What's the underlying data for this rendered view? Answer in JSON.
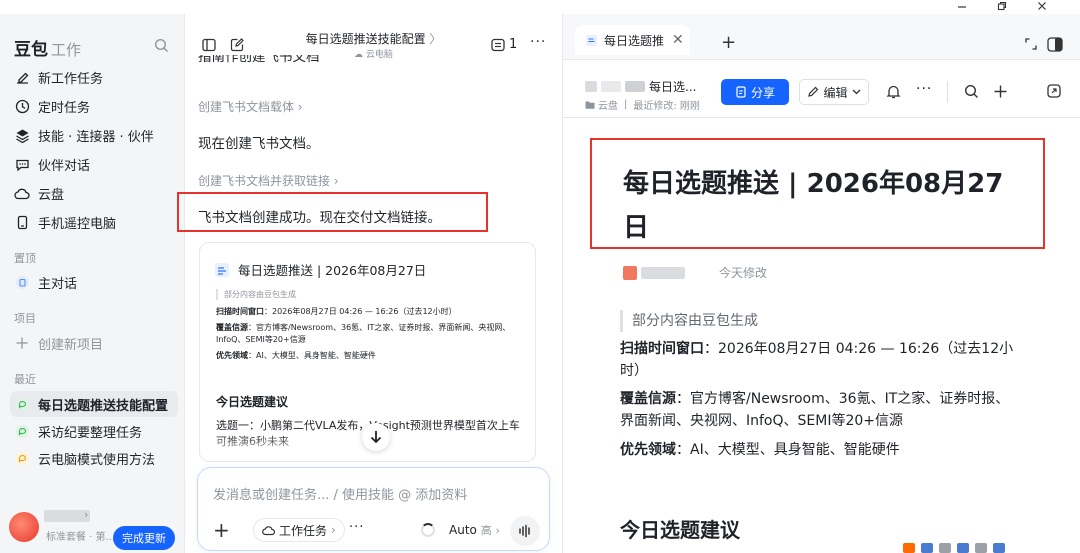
{
  "app": {
    "brand": "豆包",
    "brand_sub": "工作"
  },
  "sidebar": {
    "items": [
      {
        "label": "新工作任务",
        "icon": "edit-icon"
      },
      {
        "label": "定时任务",
        "icon": "clock-icon"
      },
      {
        "label": "技能 · 连接器 · 伙伴",
        "icon": "layers-icon"
      },
      {
        "label": "伙伴对话",
        "icon": "chat-icon"
      },
      {
        "label": "云盘",
        "icon": "cloud-icon"
      },
      {
        "label": "手机遥控电脑",
        "icon": "phone-icon"
      }
    ],
    "pinned_label": "置顶",
    "pinned": [
      {
        "label": "主对话"
      }
    ],
    "projects_label": "项目",
    "new_project": "创建新项目",
    "recent_label": "最近",
    "recent": [
      {
        "label": "每日选题推送技能配置",
        "active": true
      },
      {
        "label": "采访纪要整理任务",
        "active": false
      },
      {
        "label": "云电脑模式使用方法",
        "active": false
      }
    ],
    "account": {
      "plan": "标准套餐 · 第...",
      "upgrade": "完成更新"
    }
  },
  "chat": {
    "title": "每日选题推送技能配置",
    "subtitle": "云电脑",
    "count": "1",
    "cut_text": "指南作创建飞书文档",
    "step1": "创建飞书文档载体",
    "msg1": "现在创建飞书文档。",
    "step2": "创建飞书文档并获取链接",
    "msg2": "飞书文档创建成功。现在交付文档链接。",
    "card": {
      "title": "每日选题推送 | 2026年08月27日",
      "quote": "部分内容由豆包生成",
      "scan_label": "扫描时间窗口",
      "scan_value": "：2026年08月27日 04:26 — 16:26（过去12小时）",
      "source_label": "覆盖信源",
      "source_value": "：官方博客/Newsroom、36氪、IT之家、证券时报、界面新闻、央视网、InfoQ、SEMI等20+信源",
      "priority_label": "优先领域",
      "priority_value": "：AI、大模型、具身智能、智能硬件",
      "h2": "今日选题建议",
      "body": "选题一：小鹏第二代VLA发布，Vesight预测世界模型首次上车可推演6秒未来"
    },
    "composer": {
      "placeholder": "发消息或创建任务... / 使用技能 @ 添加资料",
      "task_pill": "工作任务",
      "mode": "Auto",
      "level": "高"
    }
  },
  "doc": {
    "tab_title": "每日选题推送",
    "doc_name": "每日选...",
    "location": "云盘",
    "modified": "最近修改: 刚刚",
    "share": "分享",
    "edit": "编辑",
    "title": "每日选题推送 | 2026年08月27日",
    "author_time": "今天修改",
    "quote": "部分内容由豆包生成",
    "scan_label": "扫描时间窗口",
    "scan_value": "：2026年08月27日 04:26 — 16:26（过去12小时）",
    "source_label": "覆盖信源",
    "source_value": "：官方博客/Newsroom、36氪、IT之家、证券时报、界面新闻、央视网、InfoQ、SEMI等20+信源",
    "priority_label": "优先领域",
    "priority_value": "：AI、大模型、具身智能、智能硬件",
    "h2": "今日选题建议"
  },
  "colors": {
    "accent": "#1664ff",
    "highlight_box": "#e5342d",
    "sidebar_bg": "#f4f5f7"
  }
}
